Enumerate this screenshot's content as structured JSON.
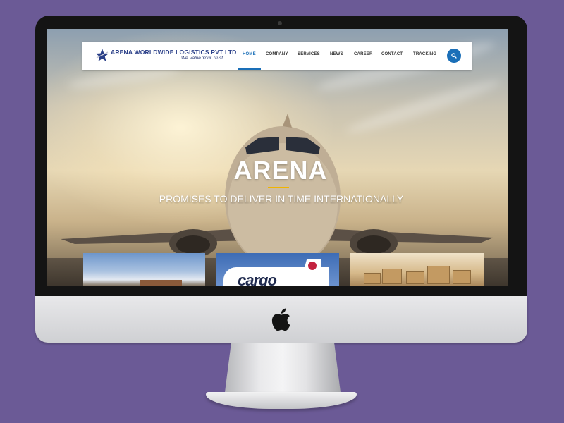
{
  "site": {
    "brand_name": "ARENA WORLDWIDE LOGISTICS PVT LTD",
    "tagline": "We Value Your Trust",
    "brand_color": "#2a3f88",
    "accent_color": "#1a6fb8",
    "highlight_color": "#f0b400"
  },
  "nav": {
    "items": [
      {
        "label": "HOME",
        "active": true
      },
      {
        "label": "COMPANY",
        "active": false
      },
      {
        "label": "SERVICES",
        "active": false
      },
      {
        "label": "NEWS",
        "active": false
      },
      {
        "label": "CAREER",
        "active": false
      },
      {
        "label": "CONTACT",
        "active": false
      },
      {
        "label": "TRACKING",
        "active": false
      }
    ],
    "search_icon": "search-icon"
  },
  "hero": {
    "title": "ARENA",
    "subtitle": "PROMISES TO DELIVER IN TIME INTERNATIONALLY"
  },
  "cards": {
    "cargo_label": "cargo"
  },
  "device": {
    "logo_icon": "apple-logo-icon",
    "background_color": "#6b5a96"
  }
}
